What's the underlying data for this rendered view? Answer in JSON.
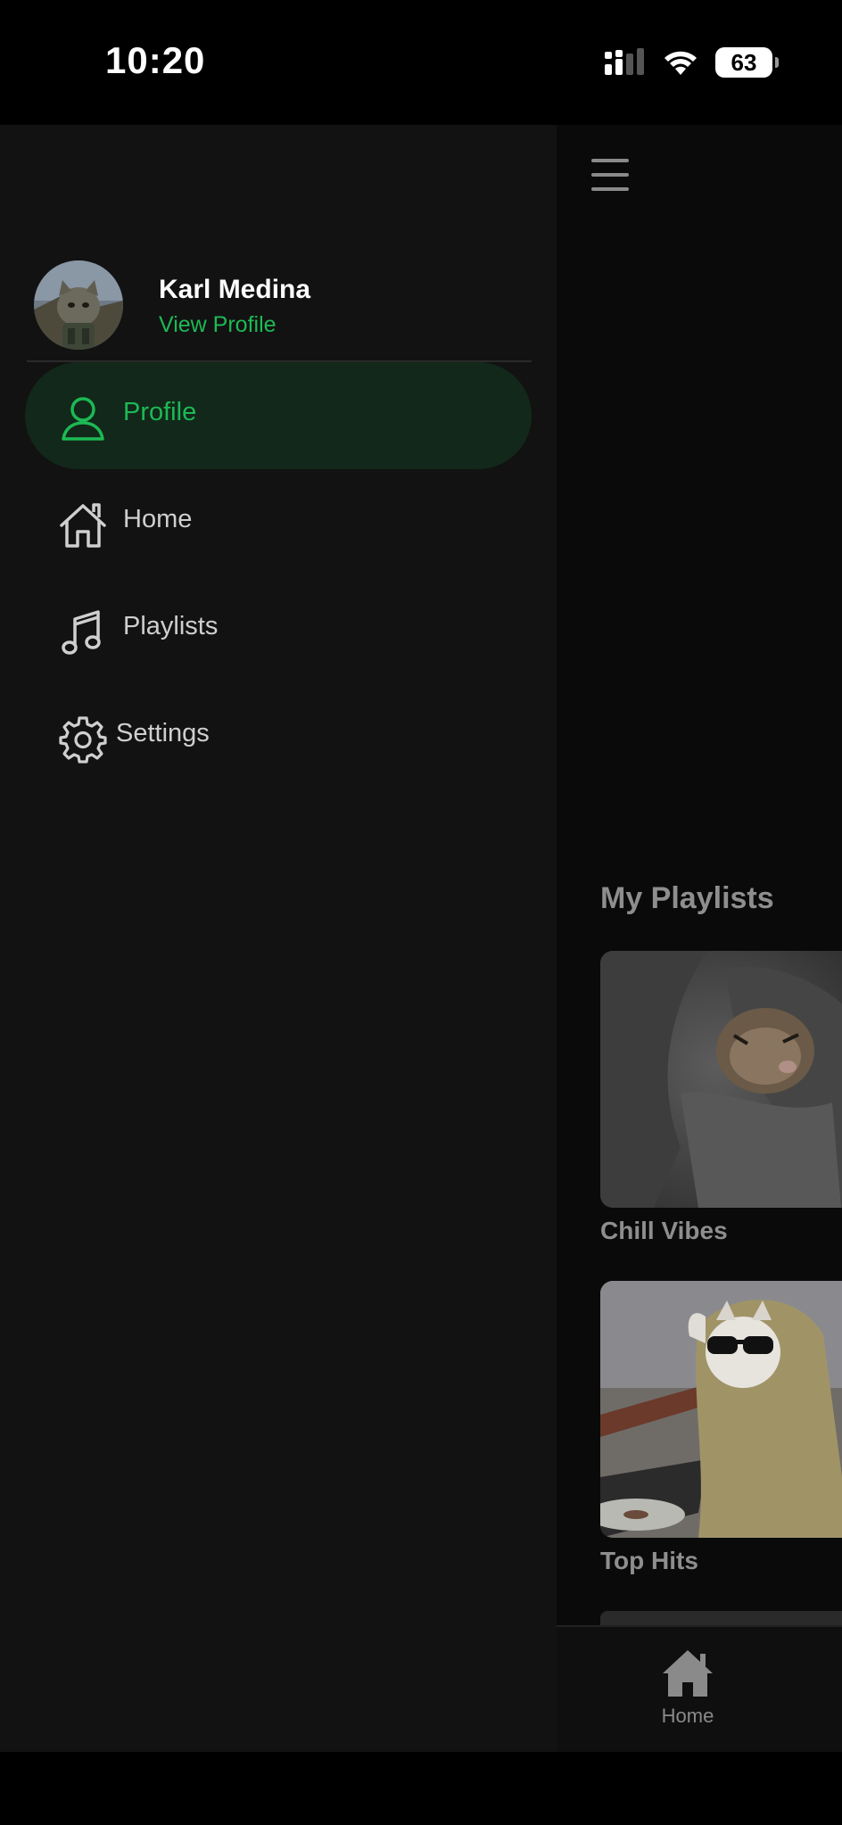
{
  "status_bar": {
    "time": "10:20",
    "battery": "63"
  },
  "drawer": {
    "user": {
      "name": "Karl Medina",
      "view_profile": "View Profile"
    },
    "nav": [
      {
        "label": "Profile",
        "icon": "person-icon",
        "active": true
      },
      {
        "label": "Home",
        "icon": "home-icon",
        "active": false
      },
      {
        "label": "Playlists",
        "icon": "music-note-icon",
        "active": false
      },
      {
        "label": "Settings",
        "icon": "gear-icon",
        "active": false
      }
    ]
  },
  "main": {
    "section_title": "My Playlists",
    "playlists": [
      {
        "name": "Chill Vibes"
      },
      {
        "name": "Top Hits"
      }
    ]
  },
  "tab_bar": {
    "home_label": "Home"
  },
  "colors": {
    "accent": "#1db954",
    "drawer_bg": "#121212",
    "active_bg": "#12281a"
  }
}
